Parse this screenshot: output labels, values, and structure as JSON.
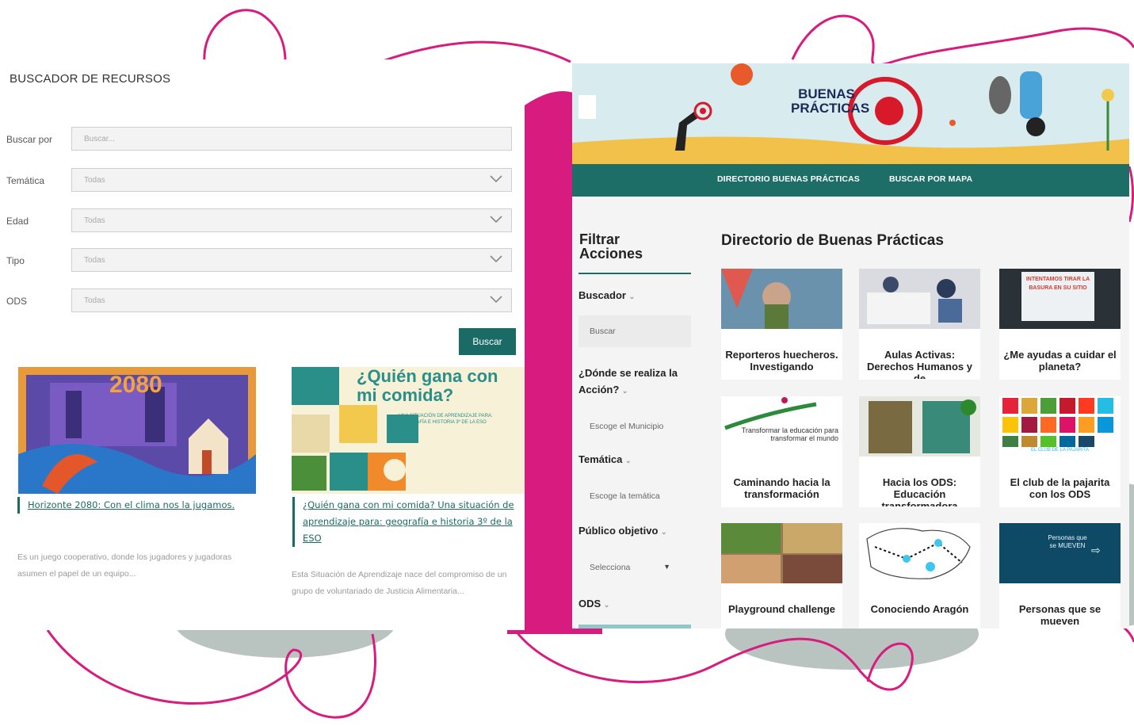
{
  "left": {
    "title": "BUSCADOR DE RECURSOS",
    "filters": [
      {
        "label": "Buscar por",
        "placeholder": "Buscar..."
      },
      {
        "label": "Temática",
        "value": "Todas"
      },
      {
        "label": "Edad",
        "value": "Todas"
      },
      {
        "label": "Tipo",
        "value": "Todas"
      },
      {
        "label": "ODS",
        "value": "Todas"
      }
    ],
    "search_button": "Buscar",
    "cards": [
      {
        "image_text": "2080",
        "title": "Horizonte 2080: Con el clima nos la jugamos.",
        "desc": "Es un juego cooperativo, donde los jugadores y jugadoras asumen el papel de un equipo..."
      },
      {
        "image_heading": "¿Quién gana con mi comida?",
        "image_sub": "UNA SITUACIÓN DE APRENDIZAJE PARA: GEOGRAFÍA E HISTORIA 3º DE LA ESO",
        "title": "¿Quién gana con mi comida? Una situación de aprendizaje para: geografía e historia 3º de la ESO",
        "desc": "Esta Situación de Aprendizaje nace del compromiso de un grupo de voluntariado de Justicia Alimentaria..."
      }
    ]
  },
  "right": {
    "logo_line1": "BUENAS",
    "logo_line2": "PRÁCTICAS",
    "nav": [
      "DIRECTORIO BUENAS PRÁCTICAS",
      "BUSCAR POR MAPA"
    ],
    "sidebar": {
      "title": "Filtrar Acciones",
      "sections": [
        {
          "heading": "Buscador",
          "field": "Buscar"
        },
        {
          "heading": "¿Dónde se realiza la Acción?",
          "field": "Escoge el Municipio"
        },
        {
          "heading": "Temática",
          "field": "Escoge la temática"
        },
        {
          "heading": "Público objetivo",
          "field": "Selecciona"
        },
        {
          "heading": "ODS",
          "field": ""
        }
      ]
    },
    "page_title": "Directorio de Buenas Prácticas",
    "grid": [
      {
        "title": "Reporteros huecheros. Investigando"
      },
      {
        "title": "Aulas Activas: Derechos Humanos y de"
      },
      {
        "title": "¿Me ayudas a cuidar el planeta?",
        "image_text": "INTENTAMOS TIRAR LA BASURA EN SU SITIO"
      },
      {
        "title": "Caminando hacia la transformación",
        "image_text": "Transformar la educación para transformar el mundo"
      },
      {
        "title": "Hacia los ODS: Educación transformadora"
      },
      {
        "title": "El club de la pajarita con los ODS",
        "image_text": "EL CLUB DE LA PAJARITA"
      },
      {
        "title": "Playground challenge"
      },
      {
        "title": "Conociendo Aragón"
      },
      {
        "title": "Personas que se mueven",
        "image_text": "Personas que se MUEVEN"
      }
    ]
  },
  "colors": {
    "accent": "#1a6b66",
    "magenta": "#d81b7e",
    "grey_blob": "#b9c4c0"
  }
}
